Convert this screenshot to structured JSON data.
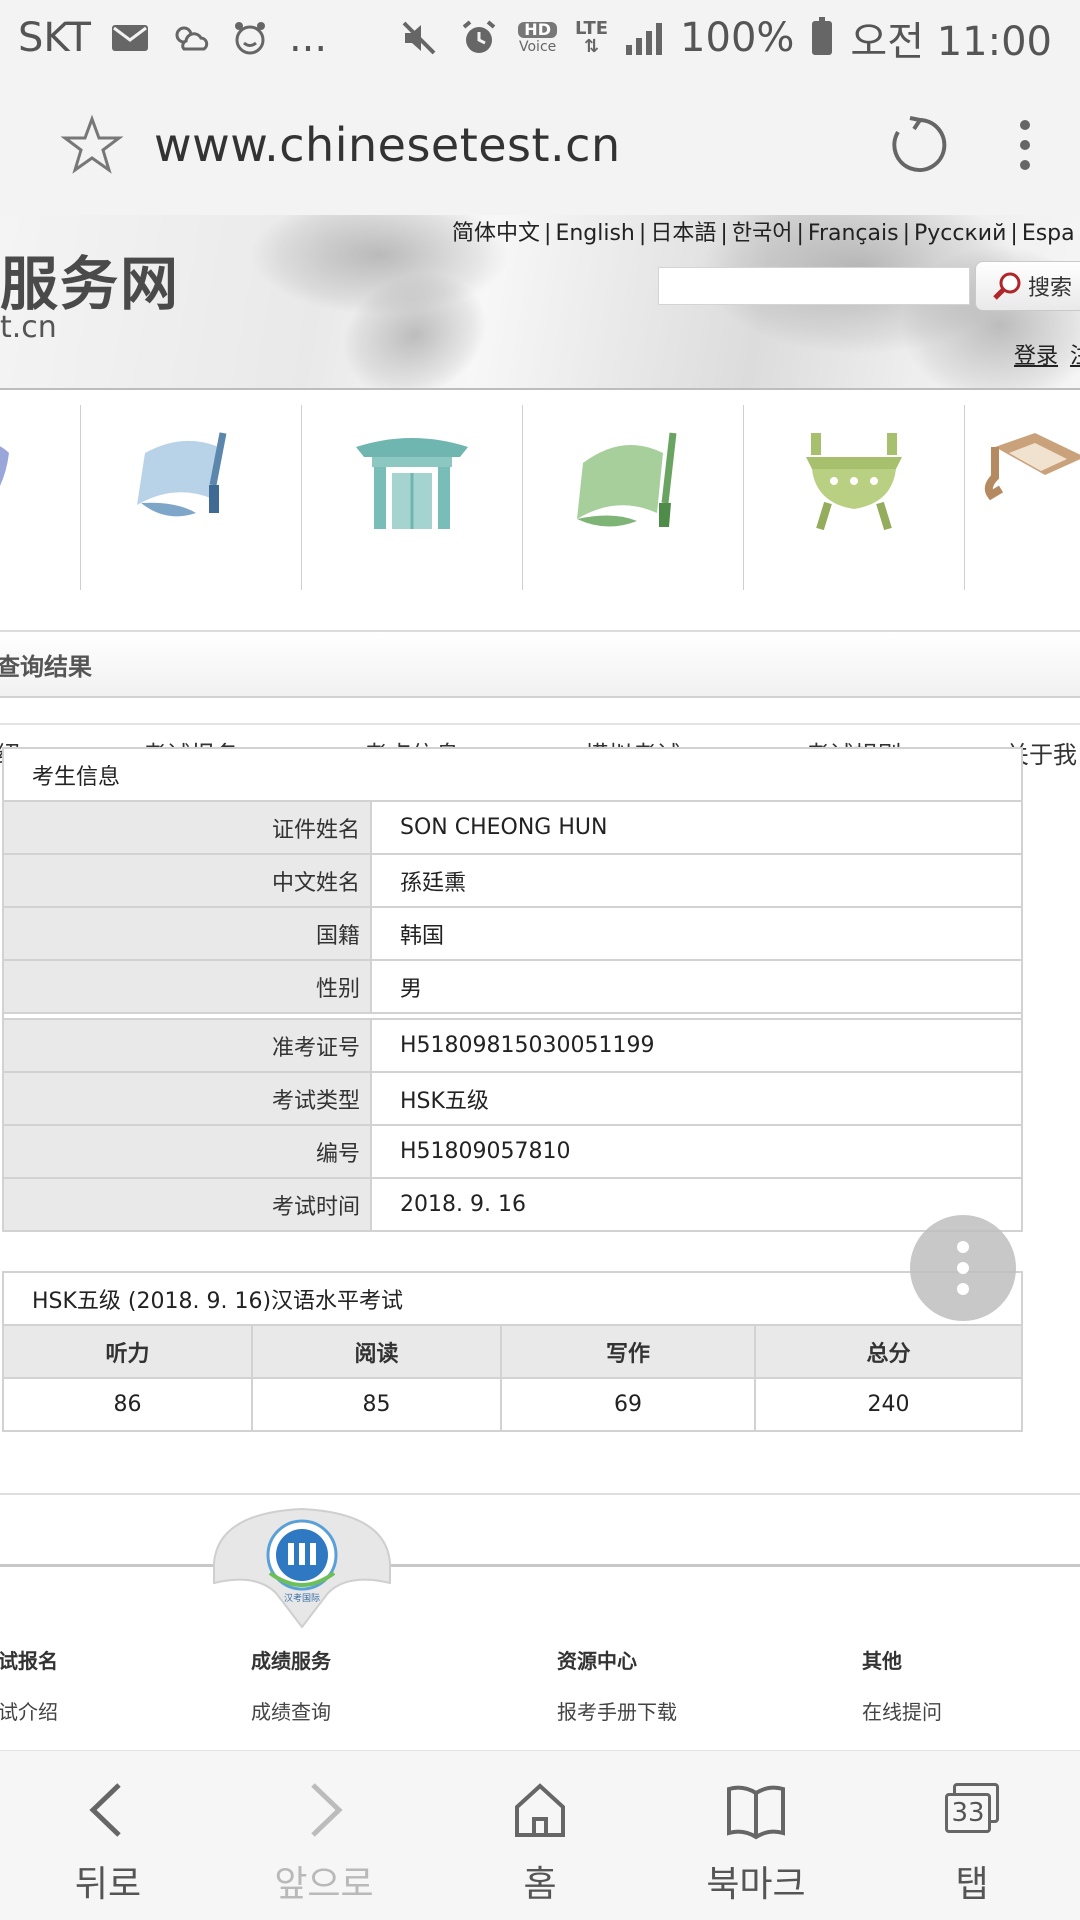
{
  "status_bar": {
    "carrier": "SKT",
    "more": "...",
    "network": "LTE",
    "hd": "HD",
    "voice": "Voice",
    "battery": "100%",
    "time": "오전 11:00"
  },
  "address_bar": {
    "url": "www.chinesetest.cn"
  },
  "banner": {
    "site_title": "服务网",
    "site_domain": "t.cn",
    "languages": [
      "简体中文",
      "English",
      "日本語",
      "한국어",
      "Français",
      "Русский",
      "Espa"
    ],
    "search_button": "搜索",
    "login": "登录",
    "register": "注"
  },
  "nav": {
    "items": [
      {
        "label": "绍"
      },
      {
        "label": "考试报名"
      },
      {
        "label": "考点信息"
      },
      {
        "label": "模拟考试"
      },
      {
        "label": "考试规则"
      },
      {
        "label": "关于我"
      }
    ]
  },
  "section": {
    "title": "查询结果"
  },
  "candidate": {
    "caption": "考生信息",
    "rows": [
      {
        "label": "证件姓名",
        "value": "SON CHEONG HUN"
      },
      {
        "label": "中文姓名",
        "value": "孫廷熏"
      },
      {
        "label": "国籍",
        "value": "韩国"
      },
      {
        "label": "性别",
        "value": "男"
      },
      {
        "label": "准考证号",
        "value": "H51809815030051199"
      },
      {
        "label": "考试类型",
        "value": "HSK五级"
      },
      {
        "label": "编号",
        "value": "H51809057810"
      },
      {
        "label": "考试时间",
        "value": "2018. 9. 16"
      }
    ]
  },
  "scores": {
    "caption": "HSK五级 (2018. 9. 16)汉语水平考试",
    "headers": [
      "听力",
      "阅读",
      "写作",
      "总分"
    ],
    "values": [
      "86",
      "85",
      "69",
      "240"
    ]
  },
  "footer": {
    "emblem_text": "汉考国际",
    "columns": [
      {
        "heading": "考试报名",
        "links": [
          "考试介绍"
        ]
      },
      {
        "heading": "成绩服务",
        "links": [
          "成绩查询"
        ]
      },
      {
        "heading": "资源中心",
        "links": [
          "报考手册下载"
        ]
      },
      {
        "heading": "其他",
        "links": [
          "在线提问"
        ]
      }
    ]
  },
  "bottom_nav": {
    "back": "뒤로",
    "forward": "앞으로",
    "home": "홈",
    "bookmarks": "북마크",
    "tabs": "탭",
    "tab_count": "33"
  }
}
